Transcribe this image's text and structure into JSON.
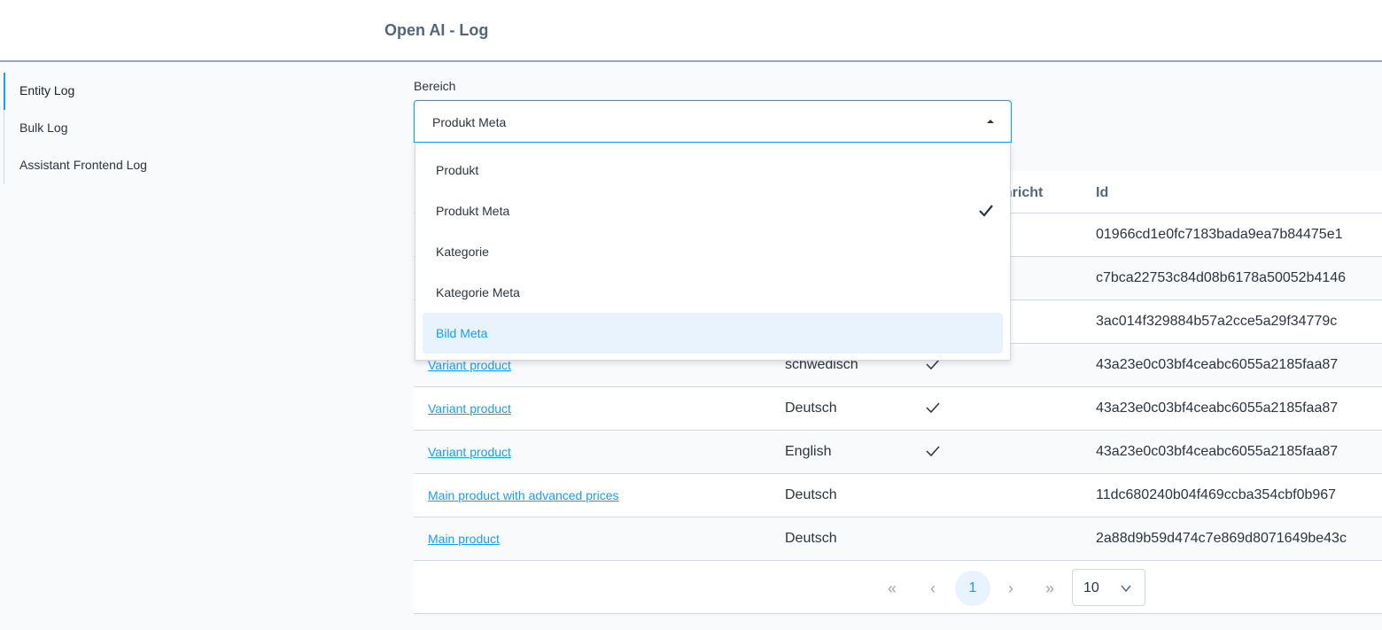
{
  "header": {
    "title": "Open AI - Log"
  },
  "sidebar": {
    "items": [
      {
        "label": "Entity Log",
        "active": true
      },
      {
        "label": "Bulk Log",
        "active": false
      },
      {
        "label": "Assistant Frontend Log",
        "active": false
      }
    ]
  },
  "filter": {
    "label": "Bereich",
    "selected": "Produkt Meta",
    "options": [
      {
        "label": "Produkt"
      },
      {
        "label": "Produkt Meta",
        "checked": true
      },
      {
        "label": "Kategorie"
      },
      {
        "label": "Kategorie Meta"
      },
      {
        "label": "Bild Meta",
        "hovered": true
      }
    ]
  },
  "table": {
    "headers": {
      "message": "chricht",
      "id": "Id"
    },
    "rows": [
      {
        "name": "",
        "language": "",
        "checked": false,
        "id": "01966cd1e0fc7183bada9ea7b84475e1"
      },
      {
        "name": "",
        "language": "",
        "checked": false,
        "id": "c7bca22753c84d08b6178a50052b4146"
      },
      {
        "name": "",
        "language": "",
        "checked": false,
        "id": "3ac014f329884b57a2cce5a29f34779c"
      },
      {
        "name": "Variant product",
        "language": "schwedisch",
        "checked": true,
        "id": "43a23e0c03bf4ceabc6055a2185faa87"
      },
      {
        "name": "Variant product",
        "language": "Deutsch",
        "checked": true,
        "id": "43a23e0c03bf4ceabc6055a2185faa87"
      },
      {
        "name": "Variant product",
        "language": "English",
        "checked": true,
        "id": "43a23e0c03bf4ceabc6055a2185faa87"
      },
      {
        "name": "Main product with advanced prices",
        "language": "Deutsch",
        "checked": false,
        "id": "11dc680240b04f469ccba354cbf0b967"
      },
      {
        "name": "Main product",
        "language": "Deutsch",
        "checked": false,
        "id": "2a88d9b59d474c7e869d8071649be43c"
      }
    ]
  },
  "pagination": {
    "first": "«",
    "prev": "‹",
    "current": "1",
    "next": "›",
    "last": "»",
    "per_page": "10"
  },
  "colors": {
    "accent": "#189eff",
    "muted": "#9aa7b8",
    "text": "#2b3440"
  },
  "icons": {
    "select_arrow": "chevron-up-icon",
    "check": "checkmark-icon",
    "per_page_arrow": "chevron-down-icon"
  }
}
